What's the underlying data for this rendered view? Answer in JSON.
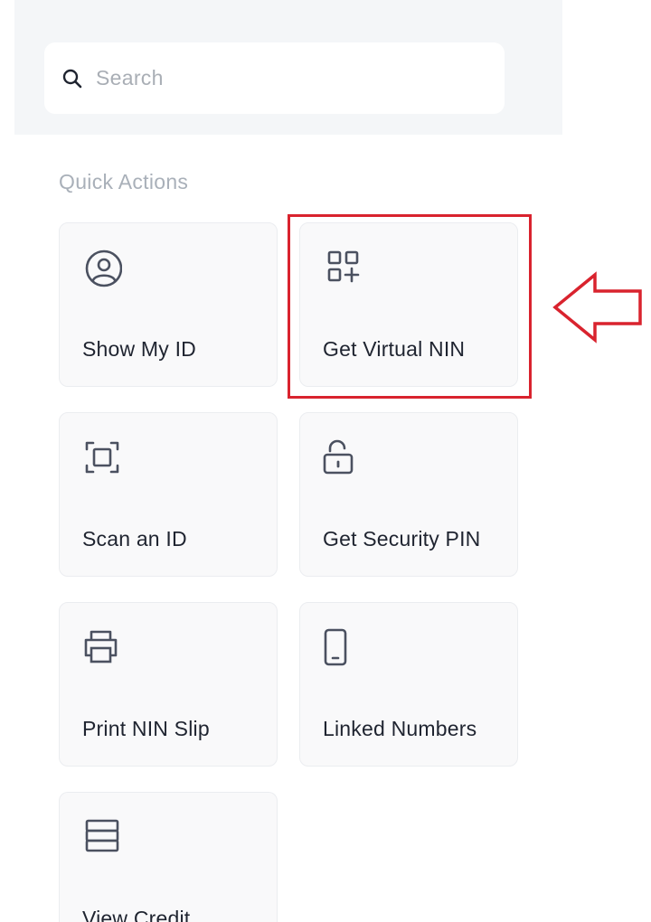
{
  "search": {
    "placeholder": "Search"
  },
  "quick_actions": {
    "title": "Quick Actions",
    "tiles": [
      {
        "label": "Show My ID",
        "icon": "user-circle-icon"
      },
      {
        "label": "Get Virtual NIN",
        "icon": "grid-plus-icon"
      },
      {
        "label": "Scan an ID",
        "icon": "scan-frame-icon"
      },
      {
        "label": "Get Security PIN",
        "icon": "unlock-icon"
      },
      {
        "label": "Print NIN Slip",
        "icon": "printer-icon"
      },
      {
        "label": "Linked Numbers",
        "icon": "mobile-phone-icon"
      },
      {
        "label": "View Credit",
        "icon": "stack-icon"
      }
    ]
  },
  "annotation": {
    "highlight_color": "#d9232e",
    "highlighted_tile": "Get Virtual NIN"
  }
}
